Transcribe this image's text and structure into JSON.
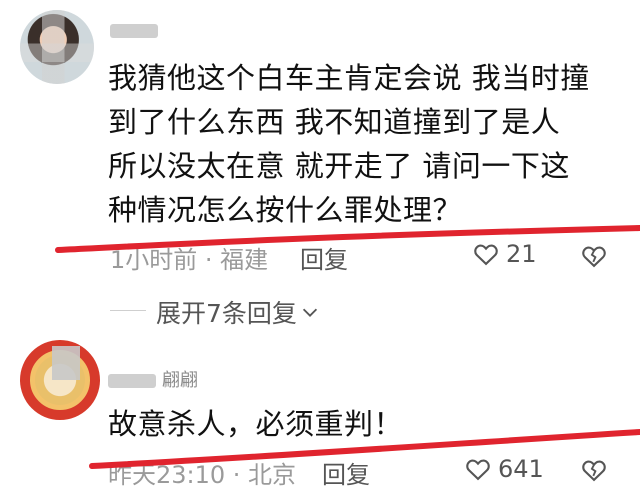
{
  "comments": [
    {
      "user": {
        "name": ""
      },
      "text": "我猜他这个白车主肯定会说 我当时撞到了什么东西 我不知道撞到了是人所以没太在意 就开走了 请问一下这种情况怎么按什么罪处理？",
      "lines": [
        "我猜他这个白车主肯定会说  我当时撞",
        "到了什么东西 我不知道撞到了是人",
        "所以没太在意   就开走了  请问一下这",
        "种情况怎么按什么罪处理？"
      ],
      "meta": "1小时前 · 福建",
      "reply_label": "回复",
      "likes": "21"
    },
    {
      "user": {
        "name": "翩翩"
      },
      "text": "故意杀人，必须重判！",
      "lines": [
        "故意杀人，必须重判！"
      ],
      "meta": "昨天23:10 · 北京",
      "reply_label": "回复",
      "likes": "641"
    }
  ],
  "expand_replies": {
    "label": "展开7条回复"
  },
  "colors": {
    "annotation_red": "#e0242e",
    "meta_gray": "#9a9a9a",
    "text": "#111111"
  },
  "icons": {
    "like": "heart-outline-icon",
    "dislike": "broken-heart-icon",
    "expand": "chevron-down-icon"
  }
}
